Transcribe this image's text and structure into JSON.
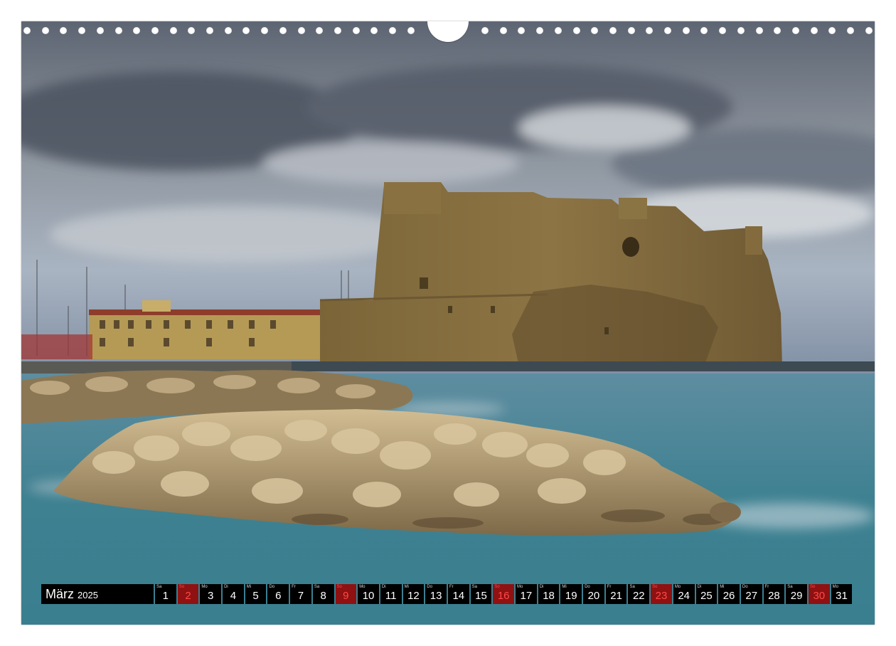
{
  "calendar": {
    "month": "März",
    "year": "2025",
    "days": [
      {
        "wd": "Sa",
        "d": "1",
        "sun": false
      },
      {
        "wd": "So",
        "d": "2",
        "sun": true
      },
      {
        "wd": "Mo",
        "d": "3",
        "sun": false
      },
      {
        "wd": "Di",
        "d": "4",
        "sun": false
      },
      {
        "wd": "Mi",
        "d": "5",
        "sun": false
      },
      {
        "wd": "Do",
        "d": "6",
        "sun": false
      },
      {
        "wd": "Fr",
        "d": "7",
        "sun": false
      },
      {
        "wd": "Sa",
        "d": "8",
        "sun": false
      },
      {
        "wd": "So",
        "d": "9",
        "sun": true
      },
      {
        "wd": "Mo",
        "d": "10",
        "sun": false
      },
      {
        "wd": "Di",
        "d": "11",
        "sun": false
      },
      {
        "wd": "Mi",
        "d": "12",
        "sun": false
      },
      {
        "wd": "Do",
        "d": "13",
        "sun": false
      },
      {
        "wd": "Fr",
        "d": "14",
        "sun": false
      },
      {
        "wd": "Sa",
        "d": "15",
        "sun": false
      },
      {
        "wd": "So",
        "d": "16",
        "sun": true
      },
      {
        "wd": "Mo",
        "d": "17",
        "sun": false
      },
      {
        "wd": "Di",
        "d": "18",
        "sun": false
      },
      {
        "wd": "Mi",
        "d": "19",
        "sun": false
      },
      {
        "wd": "Do",
        "d": "20",
        "sun": false
      },
      {
        "wd": "Fr",
        "d": "21",
        "sun": false
      },
      {
        "wd": "Sa",
        "d": "22",
        "sun": false
      },
      {
        "wd": "So",
        "d": "23",
        "sun": true
      },
      {
        "wd": "Mo",
        "d": "24",
        "sun": false
      },
      {
        "wd": "Di",
        "d": "25",
        "sun": false
      },
      {
        "wd": "Mi",
        "d": "26",
        "sun": false
      },
      {
        "wd": "Do",
        "d": "27",
        "sun": false
      },
      {
        "wd": "Fr",
        "d": "28",
        "sun": false
      },
      {
        "wd": "Sa",
        "d": "29",
        "sun": false
      },
      {
        "wd": "So",
        "d": "30",
        "sun": true
      },
      {
        "wd": "Mo",
        "d": "31",
        "sun": false
      }
    ]
  },
  "colors": {
    "strip_background": "#000000",
    "sunday_accent": "#ff4a4a",
    "sea": "#3f8593",
    "sky": "#7f8996"
  }
}
